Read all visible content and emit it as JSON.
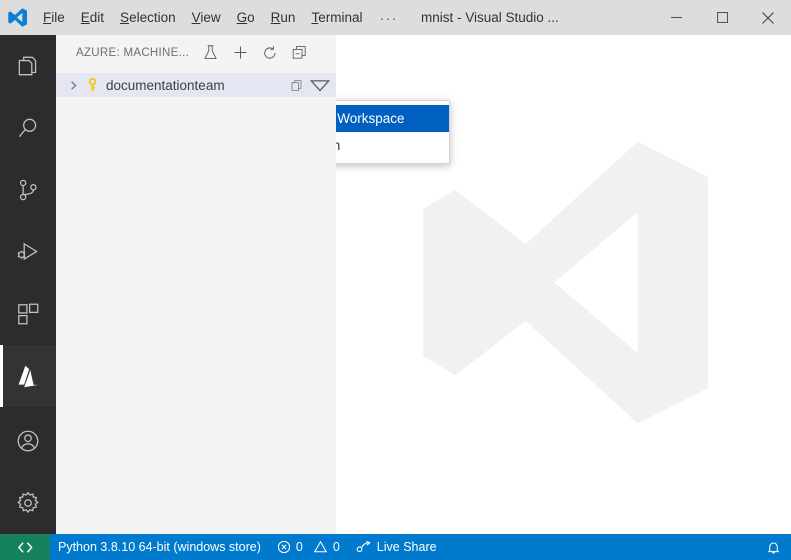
{
  "titlebar": {
    "logo_icon": "vscode-logo-icon",
    "menus": [
      {
        "label": "File",
        "accel": "F"
      },
      {
        "label": "Edit",
        "accel": "E"
      },
      {
        "label": "Selection",
        "accel": "S"
      },
      {
        "label": "View",
        "accel": "V"
      },
      {
        "label": "Go",
        "accel": "G"
      },
      {
        "label": "Run",
        "accel": "R"
      },
      {
        "label": "Terminal",
        "accel": "T"
      }
    ],
    "more_label": "···",
    "window_title": "mnist - Visual Studio ...",
    "controls": {
      "minimize": "minimize-icon",
      "maximize": "maximize-icon",
      "close": "close-icon"
    }
  },
  "activitybar": {
    "items": [
      {
        "name": "explorer",
        "icon": "files-icon",
        "active": false
      },
      {
        "name": "search",
        "icon": "search-icon",
        "active": false
      },
      {
        "name": "source-control",
        "icon": "source-control-icon",
        "active": false
      },
      {
        "name": "run-and-debug",
        "icon": "run-debug-icon",
        "active": false
      },
      {
        "name": "extensions",
        "icon": "extensions-icon",
        "active": false
      },
      {
        "name": "azure",
        "icon": "azure-icon",
        "active": true
      }
    ],
    "bottom_items": [
      {
        "name": "accounts",
        "icon": "account-icon"
      },
      {
        "name": "manage",
        "icon": "gear-icon"
      }
    ]
  },
  "sidebar": {
    "title": "AZURE: MACHINE...",
    "actions": [
      {
        "name": "run-experiment",
        "icon": "beaker-icon",
        "tooltip": "Run Experiment"
      },
      {
        "name": "add",
        "icon": "plus-icon",
        "tooltip": "Add"
      },
      {
        "name": "refresh",
        "icon": "refresh-icon",
        "tooltip": "Refresh"
      },
      {
        "name": "collapse-all",
        "icon": "collapse-all-icon",
        "tooltip": "Collapse All"
      }
    ],
    "tree": [
      {
        "label": "documentationteam",
        "icon": "key-icon",
        "expanded": false,
        "selected": true,
        "row_actions": [
          {
            "name": "copy",
            "icon": "copy-icon"
          },
          {
            "name": "filter",
            "icon": "filter-triangle-icon"
          }
        ]
      }
    ]
  },
  "editor": {
    "watermark_icon": "vscode-logo-watermark"
  },
  "context_menu": {
    "visible": true,
    "items": [
      {
        "label": "Create Workspace",
        "selected": true
      },
      {
        "label": "Refresh",
        "selected": false
      }
    ]
  },
  "statusbar": {
    "remote_icon": "remote-indicator-icon",
    "python_version": "Python 3.8.10 64-bit (windows store)",
    "errors_icon": "error-circle-icon",
    "errors_count": "0",
    "warnings_icon": "warning-triangle-icon",
    "warnings_count": "0",
    "live_share_icon": "live-share-icon",
    "live_share_label": "Live Share",
    "notifications_icon": "bell-icon"
  },
  "colors": {
    "titlebar_bg": "#dddddd",
    "activitybar_bg": "#2c2c2c",
    "sidebar_bg": "#f3f3f3",
    "editor_bg": "#ffffff",
    "statusbar_bg": "#007acc",
    "remote_bg": "#16825d",
    "menu_highlight": "#0060c0",
    "tree_selected_bg": "#e4e6f1",
    "key_icon_color": "#f2c811"
  }
}
